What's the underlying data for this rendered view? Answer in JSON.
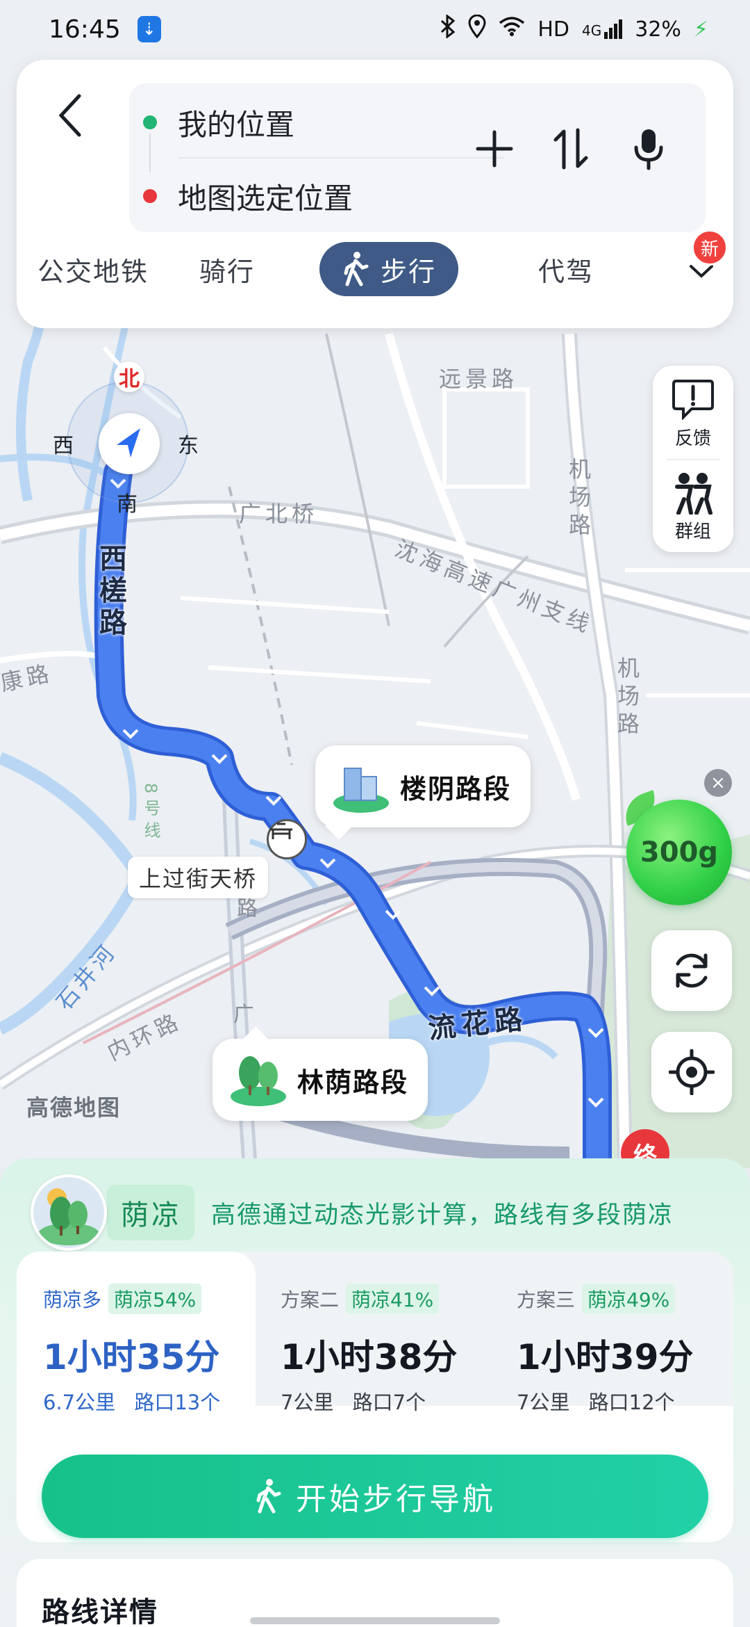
{
  "status_bar": {
    "time": "16:45",
    "usb_icon": "usb-icon",
    "right_icons": [
      "bluetooth-icon",
      "location-icon",
      "wifi-icon"
    ],
    "hd": "HD",
    "network": "4G",
    "battery": "32%"
  },
  "route_input": {
    "origin": "我的位置",
    "destination": "地图选定位置",
    "origin_color": "#22b573",
    "destination_color": "#e8373b"
  },
  "modes": {
    "tabs": [
      "公交地铁",
      "骑行",
      "步行",
      "代驾"
    ],
    "active_index": 2,
    "active_color": "#3f5a86",
    "new_badge": "新"
  },
  "compass": {
    "north": "北",
    "south": "南",
    "east": "东",
    "west": "西"
  },
  "side_tools": [
    {
      "label": "反馈",
      "icon": "feedback-icon"
    },
    {
      "label": "群组",
      "icon": "group-icon"
    }
  ],
  "eco": {
    "value": "300g",
    "close": "×"
  },
  "map": {
    "streets": {
      "yuanjing": "远景路",
      "guangbei_bridge": "广北桥",
      "shenhai": "沈海高速广州支线",
      "jichang_1": "机场路",
      "jichang_2": "机场路",
      "kang": "康路",
      "xilou": "西槎路",
      "liuhua": "流花路",
      "huanshi": "内环路",
      "shijinghe": "石井河",
      "wan": "湾路",
      "guang": "广",
      "line8": "8号线"
    },
    "overpass": "上过街天桥",
    "callout_building": "楼阴路段",
    "callout_trees": "林荫路段",
    "logo": "高德地图",
    "end_marker": "终"
  },
  "shade": {
    "tag": "荫凉",
    "description": "高德通过动态光影计算，路线有多段荫凉"
  },
  "plans": [
    {
      "name": "荫凉多",
      "shade": "荫凉54%",
      "time": "1小时35分",
      "distance": "6.7公里",
      "crossings": "路口13个",
      "selected": true
    },
    {
      "name": "方案二",
      "shade": "荫凉41%",
      "time": "1小时38分",
      "distance": "7公里",
      "crossings": "路口7个",
      "selected": false
    },
    {
      "name": "方案三",
      "shade": "荫凉49%",
      "time": "1小时39分",
      "distance": "7公里",
      "crossings": "路口12个",
      "selected": false
    }
  ],
  "start_button": "开始步行导航",
  "details_title": "路线详情",
  "colors": {
    "route": "#4477e8",
    "accent_green": "#17c18a"
  }
}
